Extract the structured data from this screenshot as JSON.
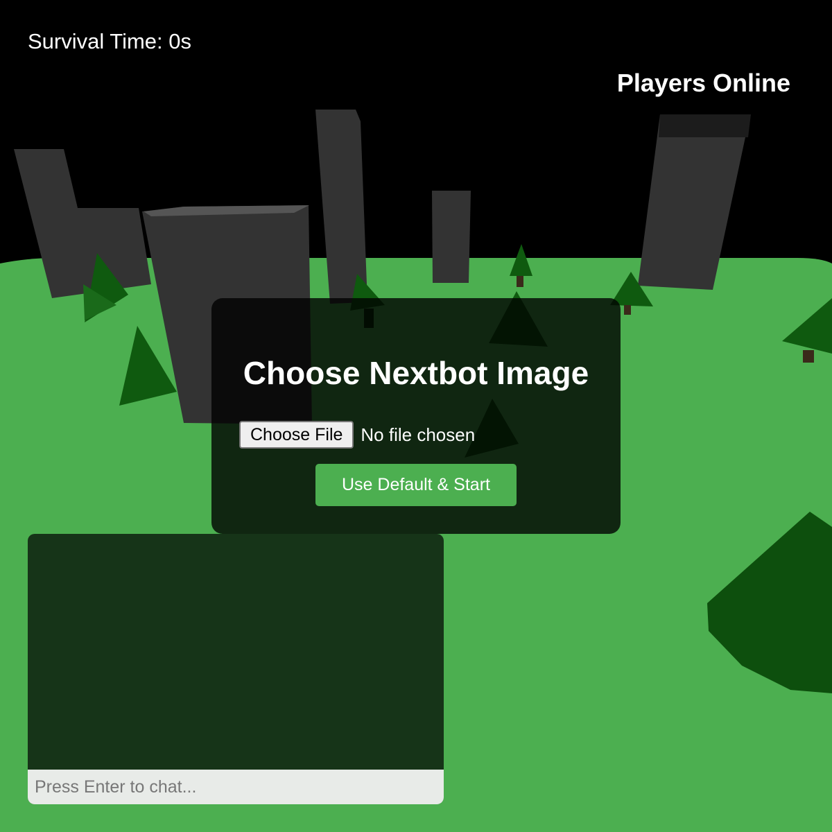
{
  "hud": {
    "survival_time": "Survival Time: 0s",
    "players_online_title": "Players Online"
  },
  "nextbot_modal": {
    "title": "Choose Nextbot Image",
    "choose_file_label": "Choose File",
    "file_status": "No file chosen",
    "start_button_label": "Use Default & Start",
    "accent_color": "#4caf50"
  },
  "chat": {
    "input_placeholder": "Press Enter to chat..."
  },
  "scene": {
    "sky_color": "#000000",
    "ground_color": "#4caf50",
    "building_color": "#333333",
    "tree_color": "#0f5a0f"
  }
}
